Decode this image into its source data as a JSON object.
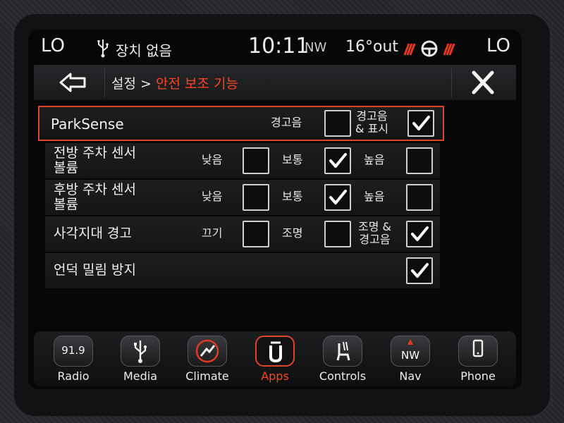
{
  "status_bar": {
    "lo_left": "LO",
    "usb_status": "장치 없음",
    "time": "10:11",
    "compass": "NW",
    "temperature": "16°out",
    "lo_right": "LO"
  },
  "header": {
    "breadcrumb_parent": "설정 >",
    "breadcrumb_current": "안전 보조 기능"
  },
  "rows": [
    {
      "label": "ParkSense",
      "options": [
        {
          "label": "경고음",
          "checked": false
        },
        {
          "label": "경고음\n& 표시",
          "checked": true
        }
      ]
    },
    {
      "label": "전방 주차 센서\n볼륨",
      "options": [
        {
          "label": "낮음",
          "checked": false
        },
        {
          "label": "보통",
          "checked": true
        },
        {
          "label": "높음",
          "checked": false
        }
      ]
    },
    {
      "label": "후방 주차 센서\n볼륨",
      "options": [
        {
          "label": "낮음",
          "checked": false
        },
        {
          "label": "보통",
          "checked": true
        },
        {
          "label": "높음",
          "checked": false
        }
      ]
    },
    {
      "label": "사각지대 경고",
      "options": [
        {
          "label": "끄기",
          "checked": false
        },
        {
          "label": "조명",
          "checked": false
        },
        {
          "label": "조명 &\n경고음",
          "checked": true
        }
      ]
    },
    {
      "label": "언덕 밀림 방지",
      "options": [
        {
          "label": "",
          "checked": true
        }
      ]
    }
  ],
  "dock": {
    "radio": {
      "label": "Radio",
      "freq": "91.9"
    },
    "media": {
      "label": "Media"
    },
    "climate": {
      "label": "Climate"
    },
    "apps": {
      "label": "Apps"
    },
    "controls": {
      "label": "Controls"
    },
    "nav": {
      "label": "Nav",
      "icon_text": "NW"
    },
    "phone": {
      "label": "Phone"
    }
  },
  "colors": {
    "accent": "#ff4422",
    "highlight_border": "#e0442a"
  }
}
